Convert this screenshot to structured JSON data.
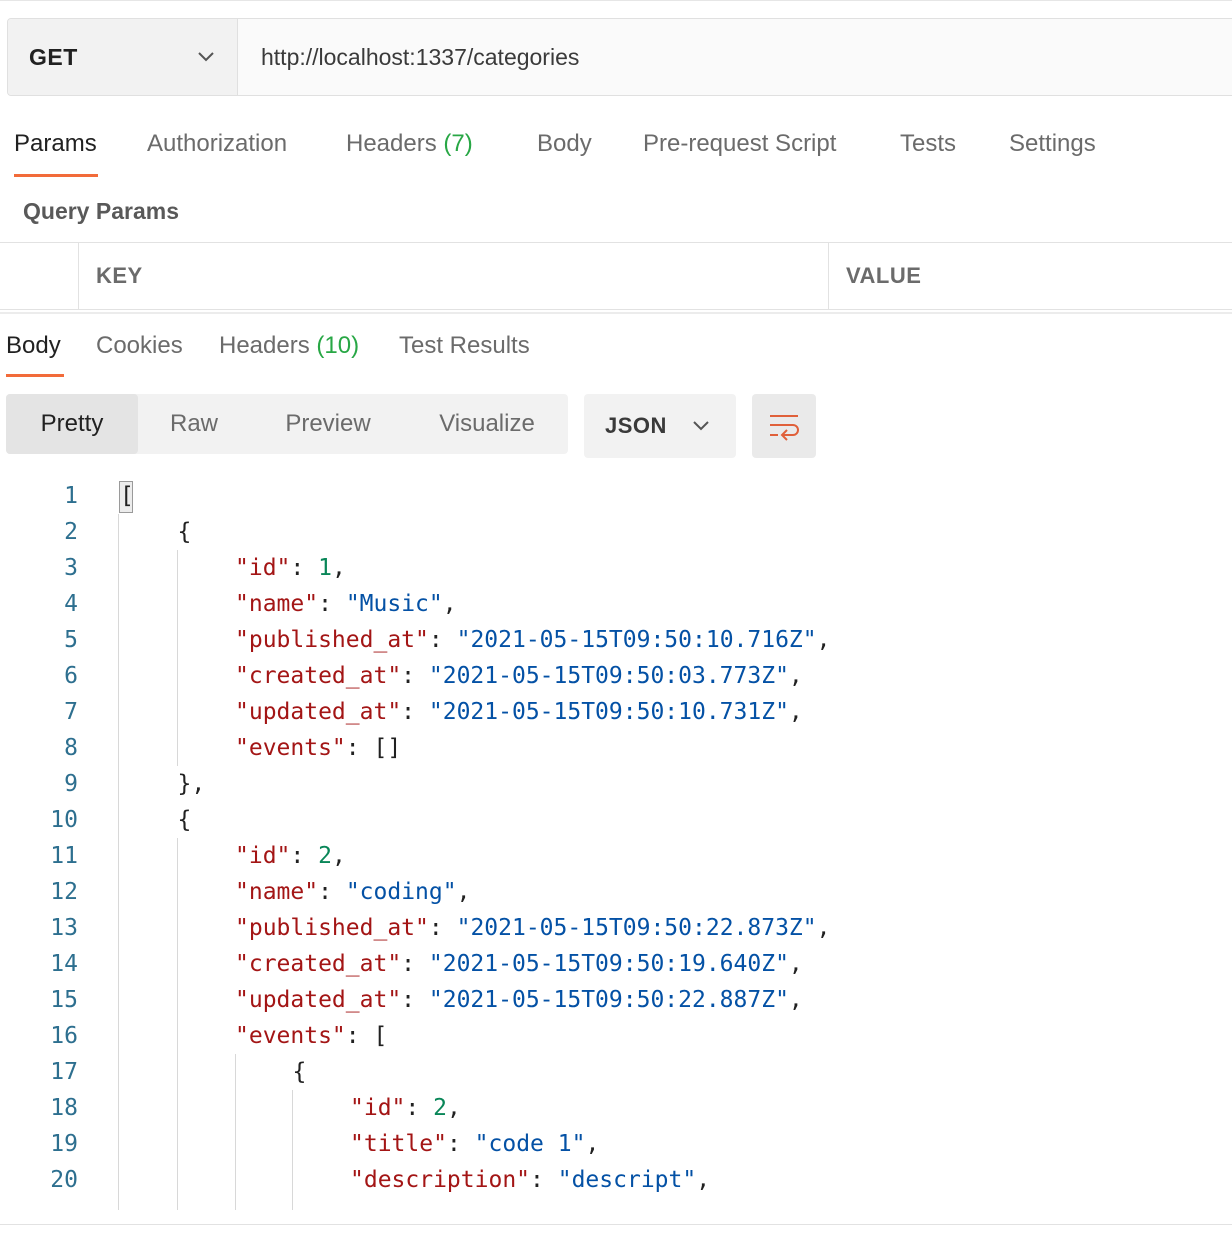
{
  "request": {
    "method": "GET",
    "url": "http://localhost:1337/categories"
  },
  "request_tabs": [
    {
      "label": "Params",
      "count": ""
    },
    {
      "label": "Authorization",
      "count": ""
    },
    {
      "label": "Headers",
      "count": "(7)"
    },
    {
      "label": "Body",
      "count": ""
    },
    {
      "label": "Pre-request Script",
      "count": ""
    },
    {
      "label": "Tests",
      "count": ""
    },
    {
      "label": "Settings",
      "count": ""
    }
  ],
  "query_params": {
    "title": "Query Params",
    "key_header": "KEY",
    "value_header": "VALUE"
  },
  "response_tabs": [
    {
      "label": "Body",
      "count": ""
    },
    {
      "label": "Cookies",
      "count": ""
    },
    {
      "label": "Headers",
      "count": "(10)"
    },
    {
      "label": "Test Results",
      "count": ""
    }
  ],
  "view_modes": [
    "Pretty",
    "Raw",
    "Preview",
    "Visualize"
  ],
  "format": "JSON",
  "code_lines": [
    "[",
    "{",
    "\"id\": 1,",
    "\"name\": \"Music\",",
    "\"published_at\": \"2021-05-15T09:50:10.716Z\",",
    "\"created_at\": \"2021-05-15T09:50:03.773Z\",",
    "\"updated_at\": \"2021-05-15T09:50:10.731Z\",",
    "\"events\": []",
    "},",
    "{",
    "\"id\": 2,",
    "\"name\": \"coding\",",
    "\"published_at\": \"2021-05-15T09:50:22.873Z\",",
    "\"created_at\": \"2021-05-15T09:50:19.640Z\",",
    "\"updated_at\": \"2021-05-15T09:50:22.887Z\",",
    "\"events\": [",
    "{",
    "\"id\": 2,",
    "\"title\": \"code 1\",",
    "\"description\": \"descript\","
  ],
  "line_numbers": [
    "1",
    "2",
    "3",
    "4",
    "5",
    "6",
    "7",
    "8",
    "9",
    "10",
    "11",
    "12",
    "13",
    "14",
    "15",
    "16",
    "17",
    "18",
    "19",
    "20"
  ],
  "colors": {
    "accent": "#f26b3a",
    "count": "#28a745",
    "json_key": "#a31515",
    "json_string": "#0451a5",
    "json_number": "#098658"
  }
}
